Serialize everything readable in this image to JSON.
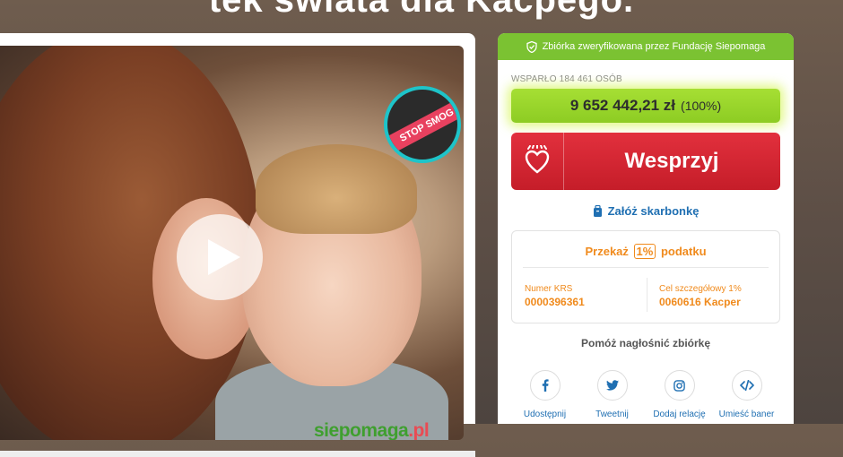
{
  "header": {
    "title": "tek świata dla Kacpego."
  },
  "media": {
    "badge_text": "STOP SMOG",
    "brand_main": "siepomaga",
    "brand_suffix": ".pl"
  },
  "panel": {
    "verified_text": "Zbiórka zweryfikowana przez Fundację Siepomaga",
    "supporters": "WSPARŁO 184 461 OSÓB",
    "amount": "9 652 442,21 zł",
    "amount_percent": "(100%)",
    "donate_label": "Wesprzyj",
    "piggybank_label": "Załóż skarbonkę",
    "tax": {
      "title_before": "Przekaż",
      "title_badge": "1%",
      "title_after": "podatku",
      "krs_label": "Numer KRS",
      "krs_value": "0000396361",
      "goal_label": "Cel szczegółowy 1%",
      "goal_value": "0060616 Kacper"
    },
    "share_title": "Pomóż nagłośnić zbiórkę",
    "share": [
      {
        "label": "Udostępnij",
        "icon": "facebook-icon"
      },
      {
        "label": "Tweetnij",
        "icon": "twitter-icon"
      },
      {
        "label": "Dodaj relację",
        "icon": "instagram-icon"
      },
      {
        "label": "Umieść baner",
        "icon": "code-icon"
      }
    ]
  },
  "colors": {
    "verified_green": "#7bc232",
    "amount_green": "#8dcc23",
    "donate_red": "#d2232f",
    "tax_orange": "#f08a1c",
    "link_blue": "#1f6fb2"
  }
}
